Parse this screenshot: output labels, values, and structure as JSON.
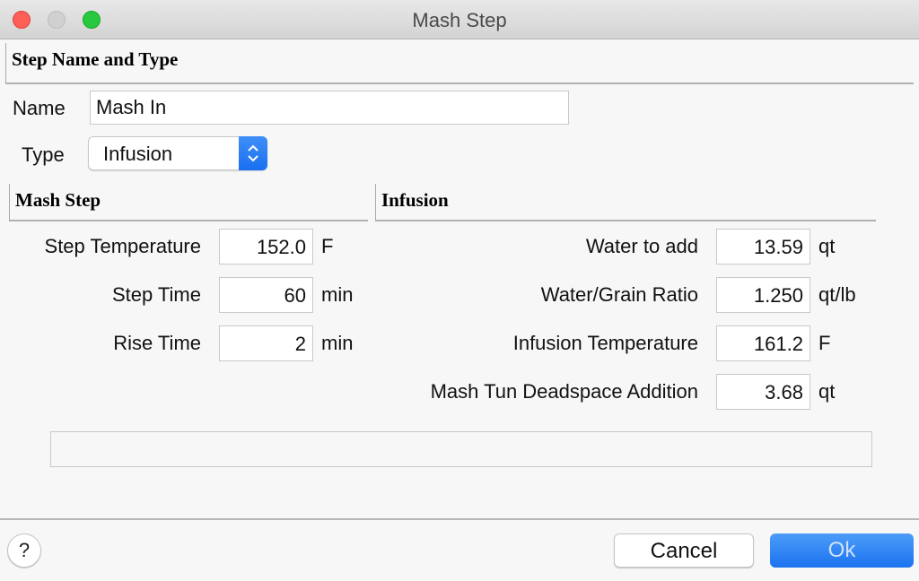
{
  "window": {
    "title": "Mash Step"
  },
  "step_name_type": {
    "header": "Step Name and Type",
    "name_label": "Name",
    "name_value": "Mash In",
    "type_label": "Type",
    "type_value": "Infusion"
  },
  "mash_step": {
    "header": "Mash Step",
    "fields": [
      {
        "label": "Step Temperature",
        "value": "152.0",
        "unit": "F"
      },
      {
        "label": "Step Time",
        "value": "60",
        "unit": "min"
      },
      {
        "label": "Rise Time",
        "value": "2",
        "unit": "min"
      }
    ]
  },
  "infusion": {
    "header": "Infusion",
    "fields": [
      {
        "label": "Water to add",
        "value": "13.59",
        "unit": "qt"
      },
      {
        "label": "Water/Grain Ratio",
        "value": "1.250",
        "unit": "qt/lb"
      },
      {
        "label": "Infusion Temperature",
        "value": "161.2",
        "unit": "F"
      },
      {
        "label": "Mash Tun Deadspace Addition",
        "value": "3.68",
        "unit": "qt"
      }
    ]
  },
  "buttons": {
    "help": "?",
    "cancel": "Cancel",
    "ok": "Ok"
  },
  "colors": {
    "accent": "#1b72f0",
    "close": "#fe5f57",
    "maximize": "#28c840"
  }
}
